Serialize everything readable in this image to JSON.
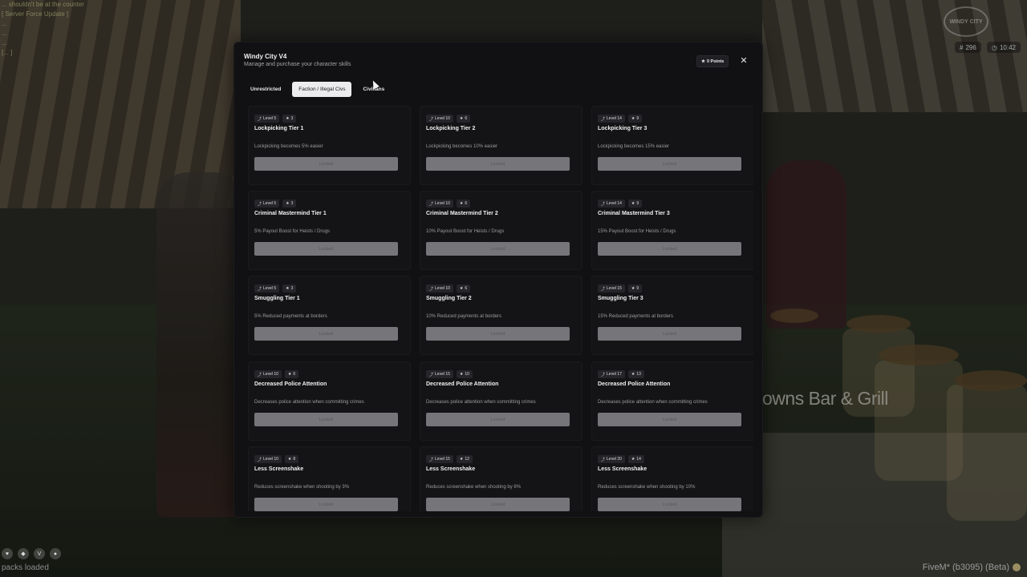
{
  "background": {
    "chat_lines": [
      "... shouldn't be at the counter",
      "[ Server Force Update ]",
      "...",
      "...",
      "...",
      "[... ]"
    ],
    "sign_text": "owns Bar & Grill",
    "server_logo_text": "WINDY CITY",
    "hud": {
      "players": "296",
      "time": "10:42"
    },
    "packs_status": "packs loaded",
    "client_version": "FiveM* (b3095) (Beta)"
  },
  "modal": {
    "title": "Windy City V4",
    "subtitle": "Manage and purchase your character skills",
    "points_label": "0 Points",
    "close_icon": "close-icon",
    "tabs": [
      {
        "label": "Unrestricted",
        "active": false
      },
      {
        "label": "Faction / Illegal Civs",
        "active": true
      },
      {
        "label": "Civilians",
        "active": false
      }
    ],
    "skills": [
      {
        "level": "Level 5",
        "cost": "3",
        "name": "Lockpicking Tier 1",
        "description": "Lockpicking becomes 5% easier",
        "button": "Locked"
      },
      {
        "level": "Level 10",
        "cost": "6",
        "name": "Lockpicking Tier 2",
        "description": "Lockpicking becomes 10% easier",
        "button": "Locked"
      },
      {
        "level": "Level 14",
        "cost": "9",
        "name": "Lockpicking Tier 3",
        "description": "Lockpicking becomes 15% easier",
        "button": "Locked"
      },
      {
        "level": "Level 5",
        "cost": "3",
        "name": "Criminal Mastermind Tier 1",
        "description": "5% Payout Boost for Heists / Drugs",
        "button": "Locked"
      },
      {
        "level": "Level 10",
        "cost": "6",
        "name": "Criminal Mastermind Tier 2",
        "description": "10% Payout Boost for Heists / Drugs",
        "button": "Locked"
      },
      {
        "level": "Level 14",
        "cost": "9",
        "name": "Criminal Mastermind Tier 3",
        "description": "15% Payout Boost for Heists / Drugs",
        "button": "Locked"
      },
      {
        "level": "Level 5",
        "cost": "3",
        "name": "Smuggling Tier 1",
        "description": "5% Reduced payments at borders",
        "button": "Locked"
      },
      {
        "level": "Level 10",
        "cost": "6",
        "name": "Smuggling Tier 2",
        "description": "10% Reduced payments at borders",
        "button": "Locked"
      },
      {
        "level": "Level 15",
        "cost": "9",
        "name": "Smuggling Tier 3",
        "description": "15% Reduced payments at borders",
        "button": "Locked"
      },
      {
        "level": "Level 10",
        "cost": "6",
        "name": "Decreased Police Attention",
        "description": "Decreases police attention when committing crimes",
        "button": "Locked"
      },
      {
        "level": "Level 15",
        "cost": "10",
        "name": "Decreased Police Attention",
        "description": "Decreases police attention when committing crimes",
        "button": "Locked"
      },
      {
        "level": "Level 17",
        "cost": "13",
        "name": "Decreased Police Attention",
        "description": "Decreases police attention when committing crimes",
        "button": "Locked"
      },
      {
        "level": "Level 10",
        "cost": "8",
        "name": "Less Screenshake",
        "description": "Reduces screenshake when shooting by 3%",
        "button": "Locked"
      },
      {
        "level": "Level 15",
        "cost": "12",
        "name": "Less Screenshake",
        "description": "Reduces screenshake when shooting by 8%",
        "button": "Locked"
      },
      {
        "level": "Level 20",
        "cost": "14",
        "name": "Less Screenshake",
        "description": "Reduces screenshake when shooting by 10%",
        "button": "Locked"
      }
    ]
  }
}
